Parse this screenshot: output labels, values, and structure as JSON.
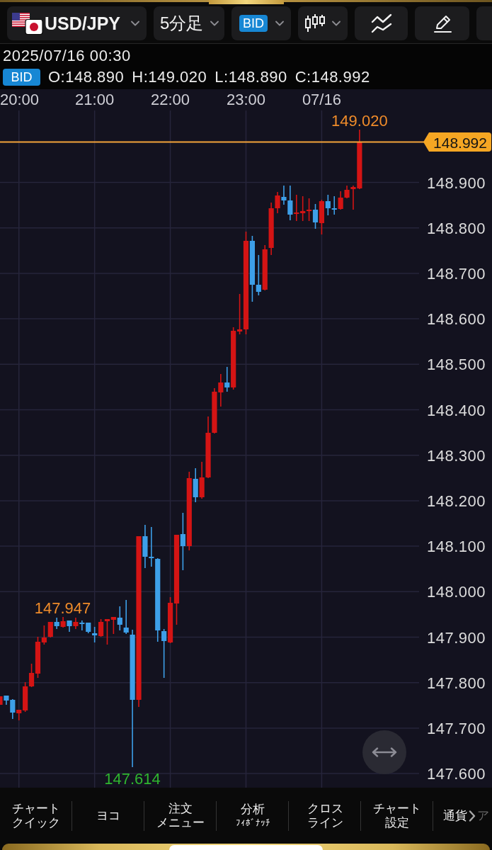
{
  "header": {
    "symbol": "USD/JPY",
    "timeframe": "5分足",
    "price_type": "BID"
  },
  "bar_info": {
    "datetime": "2025/07/16 00:30",
    "price_type": "BID",
    "open": "O:148.890",
    "high": "H:149.020",
    "low": "L:148.890",
    "close": "C:148.992"
  },
  "chart": {
    "time_labels": [
      "20:00",
      "21:00",
      "22:00",
      "23:00",
      "07/16"
    ],
    "price_labels": [
      "148.900",
      "148.800",
      "148.700",
      "148.600",
      "148.500",
      "148.400",
      "148.300",
      "148.200",
      "148.100",
      "148.000",
      "147.900",
      "147.800",
      "147.700",
      "147.600"
    ],
    "current_price": "148.992",
    "high_label": "149.020",
    "local_high_label": "147.947",
    "low_label": "147.614"
  },
  "bottom_menu": [
    {
      "kind": "text",
      "lines": [
        "チャート",
        "クイック"
      ]
    },
    {
      "kind": "text",
      "lines": [
        "ヨコ"
      ]
    },
    {
      "kind": "text",
      "lines": [
        "注文",
        "メニュー"
      ]
    },
    {
      "kind": "with_sub",
      "label": "分析",
      "sublabel": "ﾌｨﾎﾞﾅｯﾁ"
    },
    {
      "kind": "text",
      "lines": [
        "クロス",
        "ライン"
      ]
    },
    {
      "kind": "text",
      "lines": [
        "チャート",
        "設定"
      ]
    },
    {
      "kind": "overflow",
      "label": "通貨",
      "tail": "ア"
    }
  ]
}
